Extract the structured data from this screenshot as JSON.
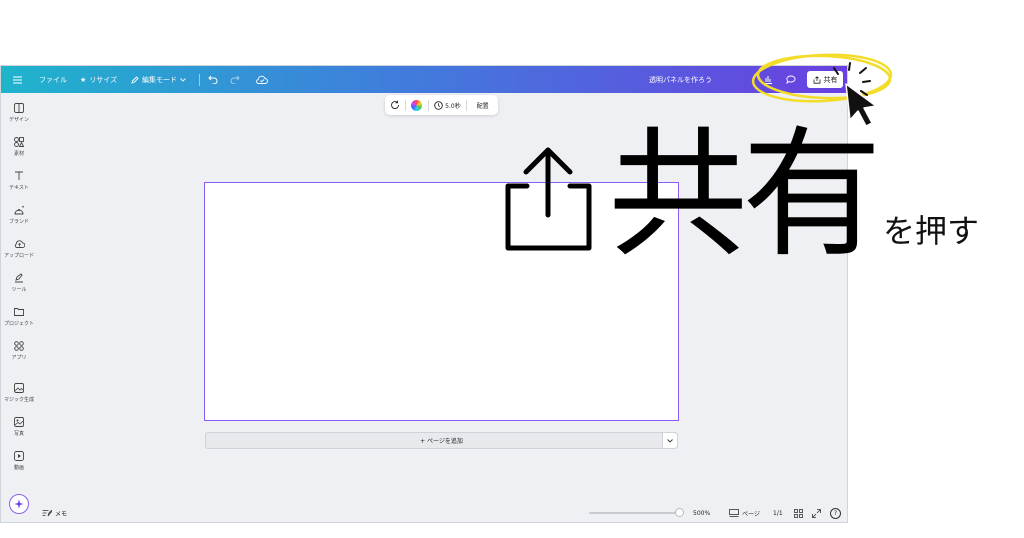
{
  "topbar": {
    "menu_icon": "hamburger-icon",
    "file_label": "ファイル",
    "resize_label": "リサイズ",
    "edit_mode_label": "編集モード",
    "doc_title": "透明パネルを作ろう",
    "share_label": "共有"
  },
  "sidebar": {
    "items": [
      {
        "label": "デザイン",
        "icon": "design-icon"
      },
      {
        "label": "素材",
        "icon": "elements-icon"
      },
      {
        "label": "テキスト",
        "icon": "text-icon"
      },
      {
        "label": "ブランド",
        "icon": "brand-icon"
      },
      {
        "label": "アップロード",
        "icon": "upload-icon"
      },
      {
        "label": "ツール",
        "icon": "pen-icon"
      },
      {
        "label": "プロジェクト",
        "icon": "folder-icon"
      },
      {
        "label": "アプリ",
        "icon": "apps-icon"
      },
      {
        "label": "マジック生成",
        "icon": "magic-image-icon"
      },
      {
        "label": "写真",
        "icon": "photo-icon"
      },
      {
        "label": "動画",
        "icon": "video-icon"
      }
    ]
  },
  "float_toolbar": {
    "duration": "5.0秒",
    "position_label": "配置"
  },
  "canvas": {
    "add_page_label": "+ ページを追加"
  },
  "bottombar": {
    "notes_label": "メモ",
    "zoom": "500%",
    "pages_label": "ページ",
    "page_count": "1/1",
    "help": "?"
  },
  "annotation": {
    "big_text": "共有",
    "small_text": "を押す",
    "highlight_color": "#f3dc2a"
  },
  "colors": {
    "topbar_start": "#1fb4cc",
    "topbar_end": "#6a3fe0",
    "canvas_border": "#8b5cf6"
  }
}
